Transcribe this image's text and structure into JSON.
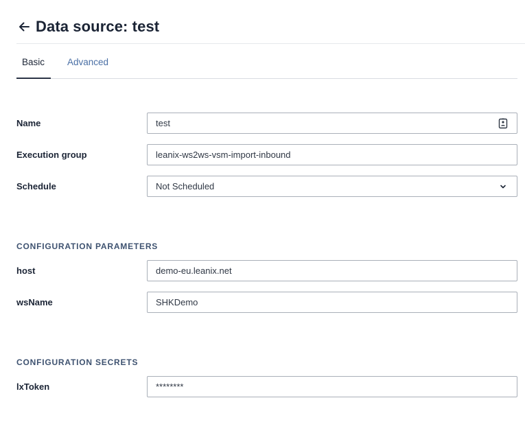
{
  "header": {
    "title": "Data source: test",
    "back_icon": "arrow-left-icon"
  },
  "tabs": [
    {
      "label": "Basic",
      "active": true
    },
    {
      "label": "Advanced",
      "active": false
    }
  ],
  "basic": {
    "name": {
      "label": "Name",
      "value": "test",
      "trailing_icon": "contact-card-icon"
    },
    "execution_group": {
      "label": "Execution group",
      "value": "leanix-ws2ws-vsm-import-inbound"
    },
    "schedule": {
      "label": "Schedule",
      "value": "Not Scheduled",
      "trailing_icon": "chevron-down-icon"
    }
  },
  "configuration_parameters": {
    "title": "CONFIGURATION PARAMETERS",
    "host": {
      "label": "host",
      "value": "demo-eu.leanix.net"
    },
    "ws_name": {
      "label": "wsName",
      "value": "SHKDemo"
    }
  },
  "configuration_secrets": {
    "title": "CONFIGURATION SECRETS",
    "lx_token": {
      "label": "lxToken",
      "value": "********"
    }
  },
  "colors": {
    "title_text": "#1b2435",
    "tab_inactive": "#4a6fa5",
    "section_title": "#3e5270",
    "field_border": "#a9afb8"
  }
}
